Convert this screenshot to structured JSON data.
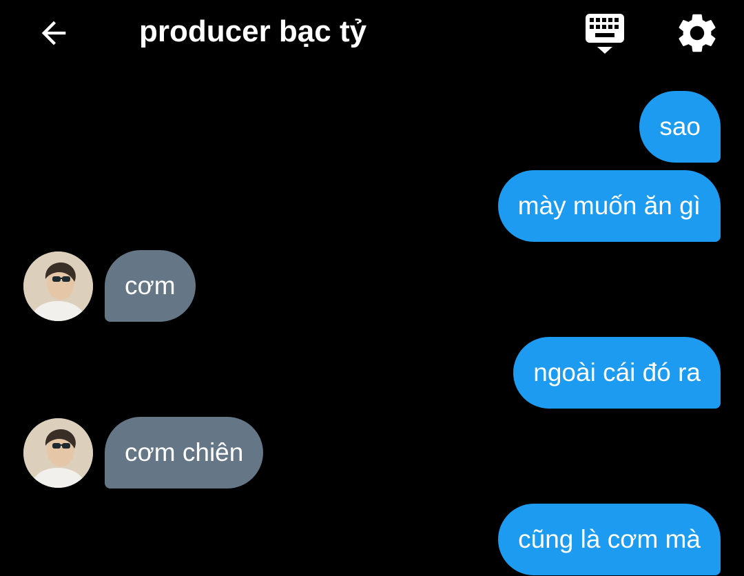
{
  "header": {
    "title": "producer bạc tỷ",
    "back_icon": "arrow-left-icon",
    "keyboard_icon": "keyboard-icon",
    "settings_icon": "gear-icon"
  },
  "colors": {
    "background": "#000000",
    "sent_bubble": "#1d9bf0",
    "received_bubble": "#657786",
    "text": "#ffffff"
  },
  "messages": [
    {
      "sender": "me",
      "text": "sao"
    },
    {
      "sender": "me",
      "text": "mày muốn ăn gì"
    },
    {
      "sender": "them",
      "text": "cơm"
    },
    {
      "sender": "me",
      "text": "ngoài cái đó ra"
    },
    {
      "sender": "them",
      "text": "cơm chiên"
    },
    {
      "sender": "me",
      "text": "cũng là cơm mà"
    }
  ]
}
